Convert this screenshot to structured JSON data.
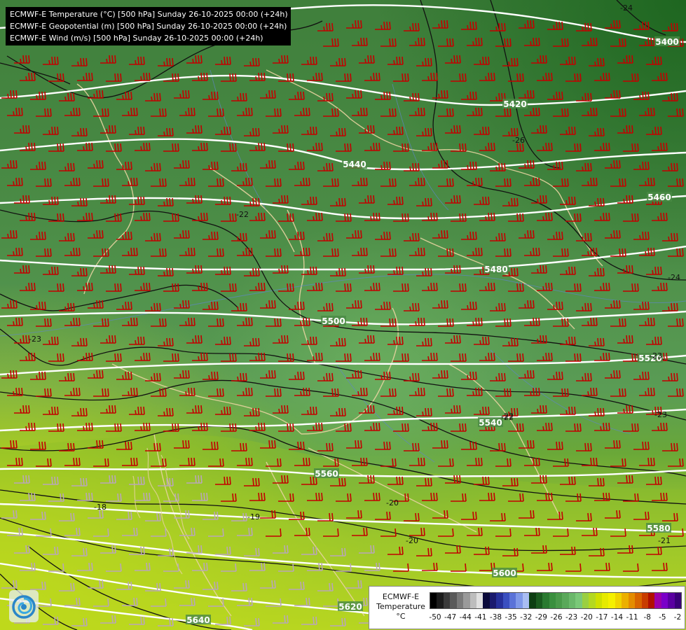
{
  "header": {
    "lines": [
      "ECMWF-E Temperature (°C) [500 hPa] Sunday 26-10-2025 00:00 (+24h)",
      "ECMWF-E Geopotential (m) [500 hPa] Sunday 26-10-2025 00:00 (+24h)",
      "ECMWF-E Wind (m/s) [500 hPa] Sunday 26-10-2025 00:00 (+24h)"
    ]
  },
  "legend": {
    "title_line1": "ECMWF-E",
    "title_line2": "Temperature",
    "unit": "°C",
    "ticks": [
      "-50",
      "-47",
      "-44",
      "-41",
      "-38",
      "-35",
      "-32",
      "-29",
      "-26",
      "-23",
      "-20",
      "-17",
      "-14",
      "-11",
      "-8",
      "-5",
      "-2"
    ],
    "colors": [
      "#000000",
      "#1c1c1c",
      "#3a3a3a",
      "#5a5a5a",
      "#7a7a7a",
      "#9a9a9a",
      "#bdbdbd",
      "#e0e0e0",
      "#0a0a3a",
      "#1a1a6e",
      "#26309a",
      "#3a4fc0",
      "#5a72d8",
      "#7f98e8",
      "#a9bdf2",
      "#0d3d12",
      "#1a5a1f",
      "#2a7a30",
      "#3a8f3e",
      "#4a9a4a",
      "#5aa85a",
      "#6ab86a",
      "#7ac878",
      "#9acf40",
      "#b4d820",
      "#cfe000",
      "#e6ea00",
      "#f5f000",
      "#f0d400",
      "#ecb000",
      "#e48c00",
      "#d86400",
      "#c83c00",
      "#b01000",
      "#9a00a8",
      "#7a00c8",
      "#5a00a0",
      "#3a0078"
    ]
  },
  "geopotential_labels": [
    {
      "text": "5400"
    },
    {
      "text": "5420"
    },
    {
      "text": "5440"
    },
    {
      "text": "5460"
    },
    {
      "text": "5480"
    },
    {
      "text": "5500"
    },
    {
      "text": "5520"
    },
    {
      "text": "5540"
    },
    {
      "text": "5560"
    },
    {
      "text": "5580"
    },
    {
      "text": "5600"
    },
    {
      "text": "5620"
    },
    {
      "text": "5640"
    }
  ],
  "temperature_labels": [
    {
      "text": "-24"
    },
    {
      "text": "-26"
    },
    {
      "text": "-22"
    },
    {
      "text": "-23"
    },
    {
      "text": "-22"
    },
    {
      "text": "-23"
    },
    {
      "text": "-24"
    },
    {
      "text": "-23"
    },
    {
      "text": "-22"
    },
    {
      "text": "-20"
    },
    {
      "text": "-18"
    },
    {
      "text": "-19"
    },
    {
      "text": "-20"
    },
    {
      "text": "-21"
    }
  ]
}
